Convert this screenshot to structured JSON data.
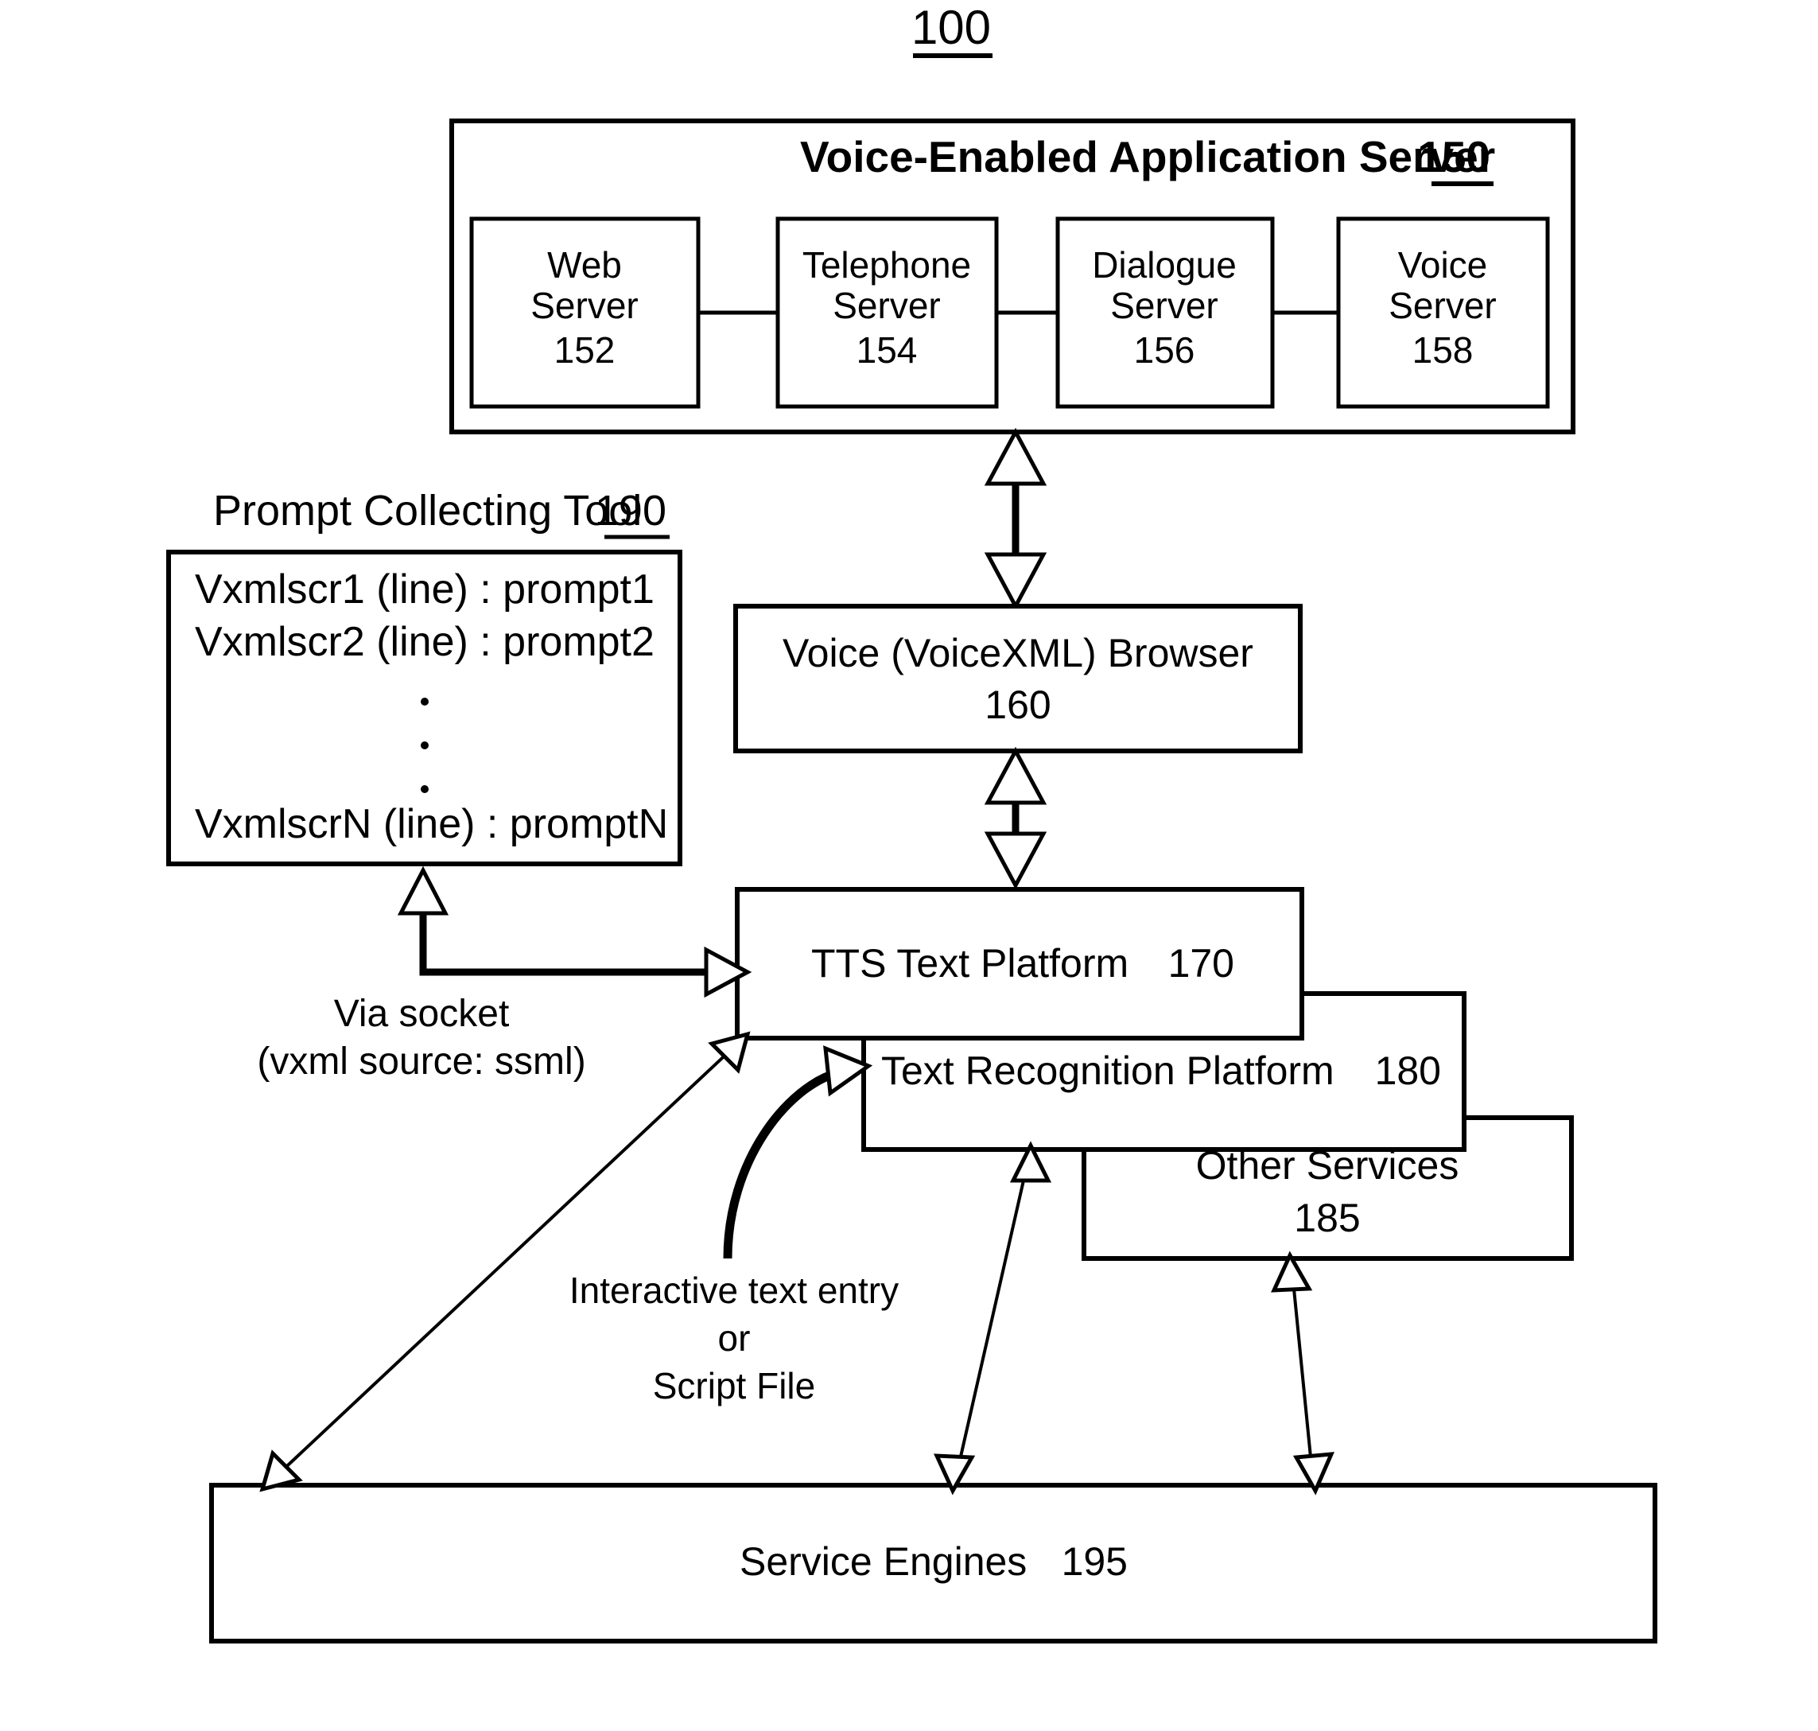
{
  "figure": {
    "number": "100"
  },
  "app_server": {
    "title": "Voice-Enabled Application Server",
    "ref": "150",
    "servers": [
      {
        "line1": "Web",
        "line2": "Server",
        "ref": "152"
      },
      {
        "line1": "Telephone",
        "line2": "Server",
        "ref": "154"
      },
      {
        "line1": "Dialogue",
        "line2": "Server",
        "ref": "156"
      },
      {
        "line1": "Voice",
        "line2": "Server",
        "ref": "158"
      }
    ]
  },
  "prompt_tool": {
    "heading": "Prompt Collecting Tool",
    "ref": "190",
    "lines": [
      "Vxmlscr1 (line) : prompt1",
      "Vxmlscr2 (line) : prompt2",
      "VxmlscrN (line) : promptN"
    ],
    "ellipsis": "."
  },
  "voice_browser": {
    "title": "Voice (VoiceXML) Browser",
    "ref": "160"
  },
  "platforms": {
    "tts": {
      "title": "TTS Text Platform",
      "ref": "170"
    },
    "recognition": {
      "title": "Text Recognition Platform",
      "ref": "180"
    },
    "other": {
      "title": "Other Services",
      "ref": "185"
    }
  },
  "service_engines": {
    "title": "Service Engines",
    "ref": "195"
  },
  "annotations": {
    "socket_line1": "Via socket",
    "socket_line2": "(vxml source:  ssml)",
    "entry_line1": "Interactive text entry",
    "entry_line2": "or",
    "entry_line3": "Script File"
  },
  "colors": {
    "ink": "#000000",
    "paper": "#ffffff"
  }
}
